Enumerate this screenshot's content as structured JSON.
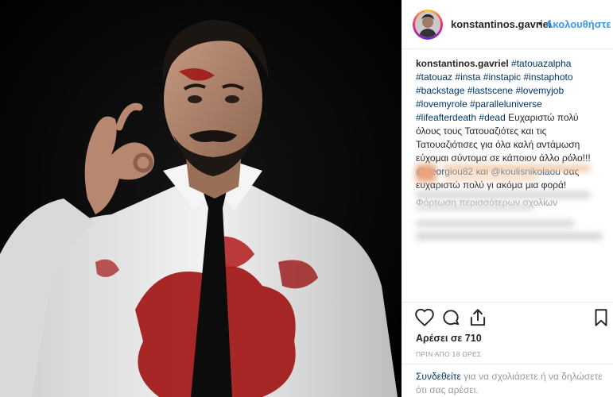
{
  "post": {
    "image_alt": "Man in a blood-stained white shirt and black tie making an OK hand gesture against a black background"
  },
  "header": {
    "username": "konstantinos.gavriel",
    "separator": "•",
    "follow_label": "Ακολουθήστε"
  },
  "caption": {
    "username": "konstantinos.gavriel",
    "hashtags_line1": "#tatouazalpha",
    "hashtags": [
      "#tatouaz",
      "#insta",
      "#instapic",
      "#instaphoto",
      "#backstage",
      "#lastscene",
      "#lovemyjob",
      "#lovemyrole",
      "#paralleluniverse",
      "#lifeafterdeath",
      "#dead"
    ],
    "text_part1": "Ευχαριστώ πολύ όλους τους Τατουαζιότες και τις Τατουαζιότισες για όλα καλή αντάμωση εύχομαι σύντομα σε κάποιον άλλο ρόλο!!! ",
    "mention1": "@georgiou82",
    "text_part2": " και ",
    "mention2": "@koulisnikolaou",
    "text_part3": " σας ευχαριστώ πολύ γι ακόμα μια φορά!"
  },
  "load_more_label": "Φόρτωση περισσότερων σχολίων",
  "actions": {
    "like_icon": "heart-icon",
    "comment_icon": "comment-icon",
    "share_icon": "share-icon",
    "save_icon": "bookmark-icon"
  },
  "likes_text": "Αρέσει σε 710",
  "timestamp": "ΠΡΙΝ ΑΠΟ 18 ΩΡΕΣ",
  "login": {
    "link_label": "Συνδεθείτε",
    "text": " για να σχολιάσετε ή να δηλώσετε ότι σας αρέσει."
  },
  "colors": {
    "link_blue": "#3897f0",
    "hashtag_blue": "#003569",
    "muted_gray": "#999999",
    "border": "#efefef"
  }
}
